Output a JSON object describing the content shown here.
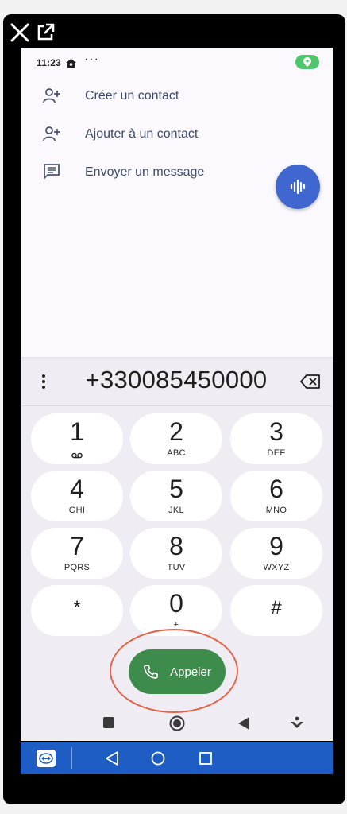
{
  "status_bar": {
    "time": "11:23",
    "more": "···"
  },
  "actions": [
    {
      "label": "Créer un contact",
      "icon": "add-person-icon"
    },
    {
      "label": "Ajouter à un contact",
      "icon": "add-person-icon"
    },
    {
      "label": "Envoyer un message",
      "icon": "message-icon"
    }
  ],
  "dialpad": {
    "number": "+330085450000",
    "keys": [
      {
        "digit": "1",
        "letters": ""
      },
      {
        "digit": "2",
        "letters": "ABC"
      },
      {
        "digit": "3",
        "letters": "DEF"
      },
      {
        "digit": "4",
        "letters": "GHI"
      },
      {
        "digit": "5",
        "letters": "JKL"
      },
      {
        "digit": "6",
        "letters": "MNO"
      },
      {
        "digit": "7",
        "letters": "PQRS"
      },
      {
        "digit": "8",
        "letters": "TUV"
      },
      {
        "digit": "9",
        "letters": "WXYZ"
      },
      {
        "digit": "*",
        "letters": ""
      },
      {
        "digit": "0",
        "letters": "+"
      },
      {
        "digit": "#",
        "letters": ""
      }
    ],
    "call_label": "Appeler"
  },
  "colors": {
    "voice_fab": "#3f67cf",
    "call_button": "#3e8c4b",
    "annotation_ring": "#e2644a",
    "taskbar": "#1e5ec4",
    "location_pill": "#4ec76c"
  }
}
